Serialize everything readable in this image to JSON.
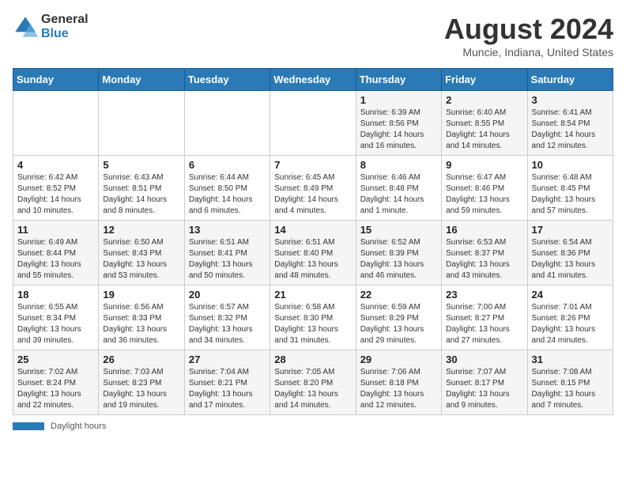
{
  "header": {
    "logo_general": "General",
    "logo_blue": "Blue",
    "title": "August 2024",
    "subtitle": "Muncie, Indiana, United States"
  },
  "days_of_week": [
    "Sunday",
    "Monday",
    "Tuesday",
    "Wednesday",
    "Thursday",
    "Friday",
    "Saturday"
  ],
  "footer": {
    "label": "Daylight hours"
  },
  "weeks": [
    [
      {
        "day": "",
        "info": ""
      },
      {
        "day": "",
        "info": ""
      },
      {
        "day": "",
        "info": ""
      },
      {
        "day": "",
        "info": ""
      },
      {
        "day": "1",
        "info": "Sunrise: 6:39 AM\nSunset: 8:56 PM\nDaylight: 14 hours\nand 16 minutes."
      },
      {
        "day": "2",
        "info": "Sunrise: 6:40 AM\nSunset: 8:55 PM\nDaylight: 14 hours\nand 14 minutes."
      },
      {
        "day": "3",
        "info": "Sunrise: 6:41 AM\nSunset: 8:54 PM\nDaylight: 14 hours\nand 12 minutes."
      }
    ],
    [
      {
        "day": "4",
        "info": "Sunrise: 6:42 AM\nSunset: 8:52 PM\nDaylight: 14 hours\nand 10 minutes."
      },
      {
        "day": "5",
        "info": "Sunrise: 6:43 AM\nSunset: 8:51 PM\nDaylight: 14 hours\nand 8 minutes."
      },
      {
        "day": "6",
        "info": "Sunrise: 6:44 AM\nSunset: 8:50 PM\nDaylight: 14 hours\nand 6 minutes."
      },
      {
        "day": "7",
        "info": "Sunrise: 6:45 AM\nSunset: 8:49 PM\nDaylight: 14 hours\nand 4 minutes."
      },
      {
        "day": "8",
        "info": "Sunrise: 6:46 AM\nSunset: 8:48 PM\nDaylight: 14 hours\nand 1 minute."
      },
      {
        "day": "9",
        "info": "Sunrise: 6:47 AM\nSunset: 8:46 PM\nDaylight: 13 hours\nand 59 minutes."
      },
      {
        "day": "10",
        "info": "Sunrise: 6:48 AM\nSunset: 8:45 PM\nDaylight: 13 hours\nand 57 minutes."
      }
    ],
    [
      {
        "day": "11",
        "info": "Sunrise: 6:49 AM\nSunset: 8:44 PM\nDaylight: 13 hours\nand 55 minutes."
      },
      {
        "day": "12",
        "info": "Sunrise: 6:50 AM\nSunset: 8:43 PM\nDaylight: 13 hours\nand 53 minutes."
      },
      {
        "day": "13",
        "info": "Sunrise: 6:51 AM\nSunset: 8:41 PM\nDaylight: 13 hours\nand 50 minutes."
      },
      {
        "day": "14",
        "info": "Sunrise: 6:51 AM\nSunset: 8:40 PM\nDaylight: 13 hours\nand 48 minutes."
      },
      {
        "day": "15",
        "info": "Sunrise: 6:52 AM\nSunset: 8:39 PM\nDaylight: 13 hours\nand 46 minutes."
      },
      {
        "day": "16",
        "info": "Sunrise: 6:53 AM\nSunset: 8:37 PM\nDaylight: 13 hours\nand 43 minutes."
      },
      {
        "day": "17",
        "info": "Sunrise: 6:54 AM\nSunset: 8:36 PM\nDaylight: 13 hours\nand 41 minutes."
      }
    ],
    [
      {
        "day": "18",
        "info": "Sunrise: 6:55 AM\nSunset: 8:34 PM\nDaylight: 13 hours\nand 39 minutes."
      },
      {
        "day": "19",
        "info": "Sunrise: 6:56 AM\nSunset: 8:33 PM\nDaylight: 13 hours\nand 36 minutes."
      },
      {
        "day": "20",
        "info": "Sunrise: 6:57 AM\nSunset: 8:32 PM\nDaylight: 13 hours\nand 34 minutes."
      },
      {
        "day": "21",
        "info": "Sunrise: 6:58 AM\nSunset: 8:30 PM\nDaylight: 13 hours\nand 31 minutes."
      },
      {
        "day": "22",
        "info": "Sunrise: 6:59 AM\nSunset: 8:29 PM\nDaylight: 13 hours\nand 29 minutes."
      },
      {
        "day": "23",
        "info": "Sunrise: 7:00 AM\nSunset: 8:27 PM\nDaylight: 13 hours\nand 27 minutes."
      },
      {
        "day": "24",
        "info": "Sunrise: 7:01 AM\nSunset: 8:26 PM\nDaylight: 13 hours\nand 24 minutes."
      }
    ],
    [
      {
        "day": "25",
        "info": "Sunrise: 7:02 AM\nSunset: 8:24 PM\nDaylight: 13 hours\nand 22 minutes."
      },
      {
        "day": "26",
        "info": "Sunrise: 7:03 AM\nSunset: 8:23 PM\nDaylight: 13 hours\nand 19 minutes."
      },
      {
        "day": "27",
        "info": "Sunrise: 7:04 AM\nSunset: 8:21 PM\nDaylight: 13 hours\nand 17 minutes."
      },
      {
        "day": "28",
        "info": "Sunrise: 7:05 AM\nSunset: 8:20 PM\nDaylight: 13 hours\nand 14 minutes."
      },
      {
        "day": "29",
        "info": "Sunrise: 7:06 AM\nSunset: 8:18 PM\nDaylight: 13 hours\nand 12 minutes."
      },
      {
        "day": "30",
        "info": "Sunrise: 7:07 AM\nSunset: 8:17 PM\nDaylight: 13 hours\nand 9 minutes."
      },
      {
        "day": "31",
        "info": "Sunrise: 7:08 AM\nSunset: 8:15 PM\nDaylight: 13 hours\nand 7 minutes."
      }
    ]
  ]
}
